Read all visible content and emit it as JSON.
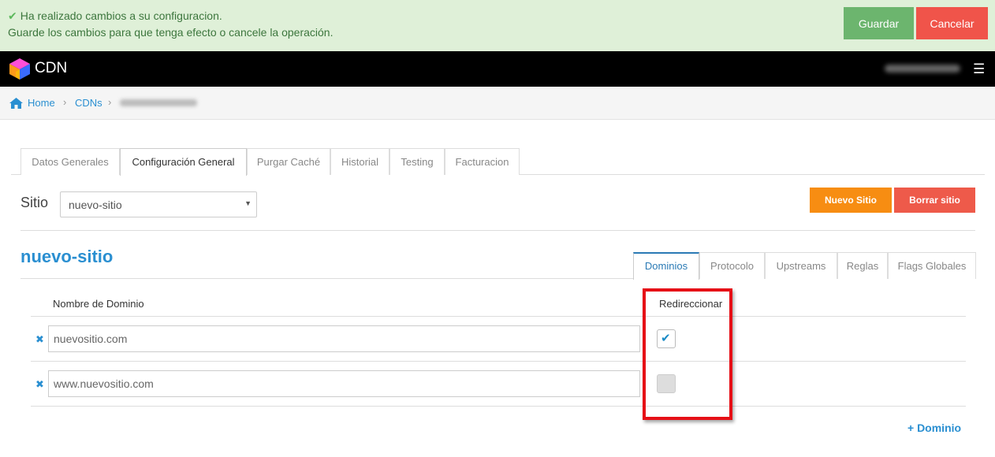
{
  "notification": {
    "line1": "Ha realizado cambios a su configuracion.",
    "line2": "Guarde los cambios para que tenga efecto o cancele la operación.",
    "save_label": "Guardar",
    "cancel_label": "Cancelar",
    "icon": "check-icon"
  },
  "navbar": {
    "brand": "CDN",
    "menu_icon": "hamburger-icon"
  },
  "breadcrumb": {
    "home": "Home",
    "cdns": "CDNs",
    "separator": "›"
  },
  "tabs": [
    {
      "label": "Datos Generales"
    },
    {
      "label": "Configuración General"
    },
    {
      "label": "Purgar Caché"
    },
    {
      "label": "Historial"
    },
    {
      "label": "Testing"
    },
    {
      "label": "Facturacion"
    }
  ],
  "site": {
    "label": "Sitio",
    "selected": "nuevo-sitio",
    "new_label": "Nuevo Sitio",
    "delete_label": "Borrar sitio",
    "title": "nuevo-sitio"
  },
  "subtabs": [
    {
      "label": "Dominios"
    },
    {
      "label": "Protocolo"
    },
    {
      "label": "Upstreams"
    },
    {
      "label": "Reglas"
    },
    {
      "label": "Flags Globales"
    }
  ],
  "domains": {
    "col_name": "Nombre de Dominio",
    "col_redirect": "Redireccionar",
    "rows": [
      {
        "name": "nuevositio.com",
        "redirect": true
      },
      {
        "name": "www.nuevositio.com",
        "redirect": false
      }
    ],
    "add_label": "+ Dominio",
    "remove_icon": "times-icon"
  },
  "colors": {
    "accent": "#2a8fd1",
    "success_bg": "#dff0d8",
    "save": "#6cb56e",
    "cancel": "#f0544a",
    "new_site": "#f78d12",
    "highlight": "#e60f16"
  }
}
